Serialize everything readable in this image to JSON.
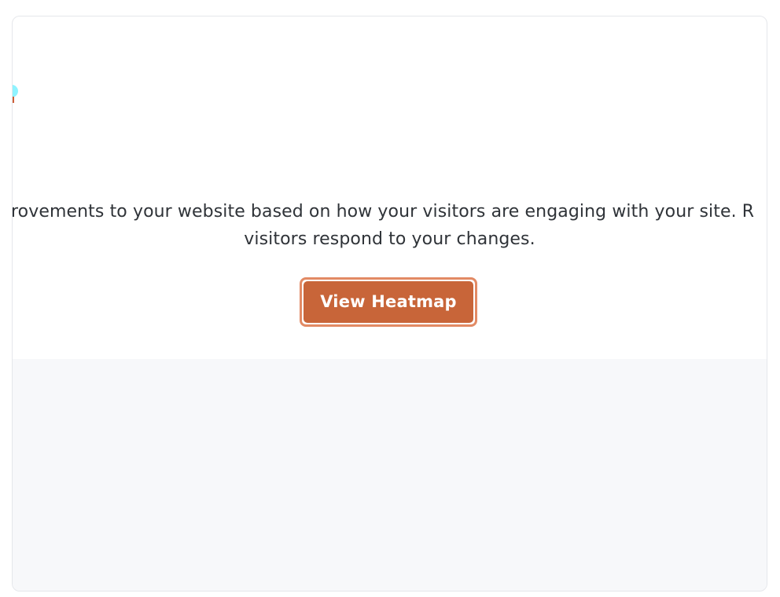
{
  "card": {
    "description_line_1": "rovements to your website based on how your visitors are engaging with your site. R",
    "description_line_2": "visitors respond to your changes.",
    "button_label": "View Heatmap"
  },
  "colors": {
    "accent": "#c86539",
    "accent_border": "#e28a64",
    "text": "#2f3338",
    "background_panel": "#f7f8fa",
    "illustration_cyan": "#8ff3ff",
    "illustration_orange": "#cd5f39"
  },
  "icons": {
    "illustration_fragment": "heatmap-illustration-fragment"
  }
}
